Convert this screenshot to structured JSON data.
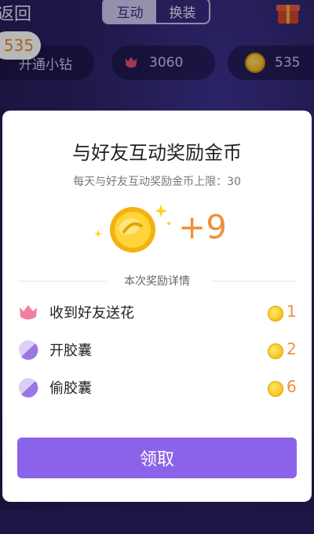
{
  "header": {
    "back_label": "返回",
    "tabs": [
      {
        "label": "互动",
        "active": true
      },
      {
        "label": "换装",
        "active": false
      }
    ],
    "gift_icon": "gift-icon"
  },
  "resources": {
    "badge_value": "535",
    "items": [
      {
        "label": "开通小钻",
        "icon": "diamond-icon"
      },
      {
        "label": "3060",
        "icon": "rose-icon"
      },
      {
        "label": "535",
        "icon": "coin-icon"
      }
    ]
  },
  "modal": {
    "title": "与好友互动奖励金币",
    "subtitle": "每天与好友互动奖励金币上限：30",
    "reward_amount": "+9",
    "divider_label": "本次奖励详情",
    "rows": [
      {
        "label": "收到好友送花",
        "icon": "rose-icon",
        "value": "1"
      },
      {
        "label": "开胶囊",
        "icon": "capsule-icon",
        "value": "2"
      },
      {
        "label": "偷胶囊",
        "icon": "capsule-icon",
        "value": "6"
      }
    ],
    "claim_label": "领取"
  },
  "colors": {
    "accent": "#8b63e8",
    "reward": "#f0913a",
    "background": "#2b2160"
  }
}
